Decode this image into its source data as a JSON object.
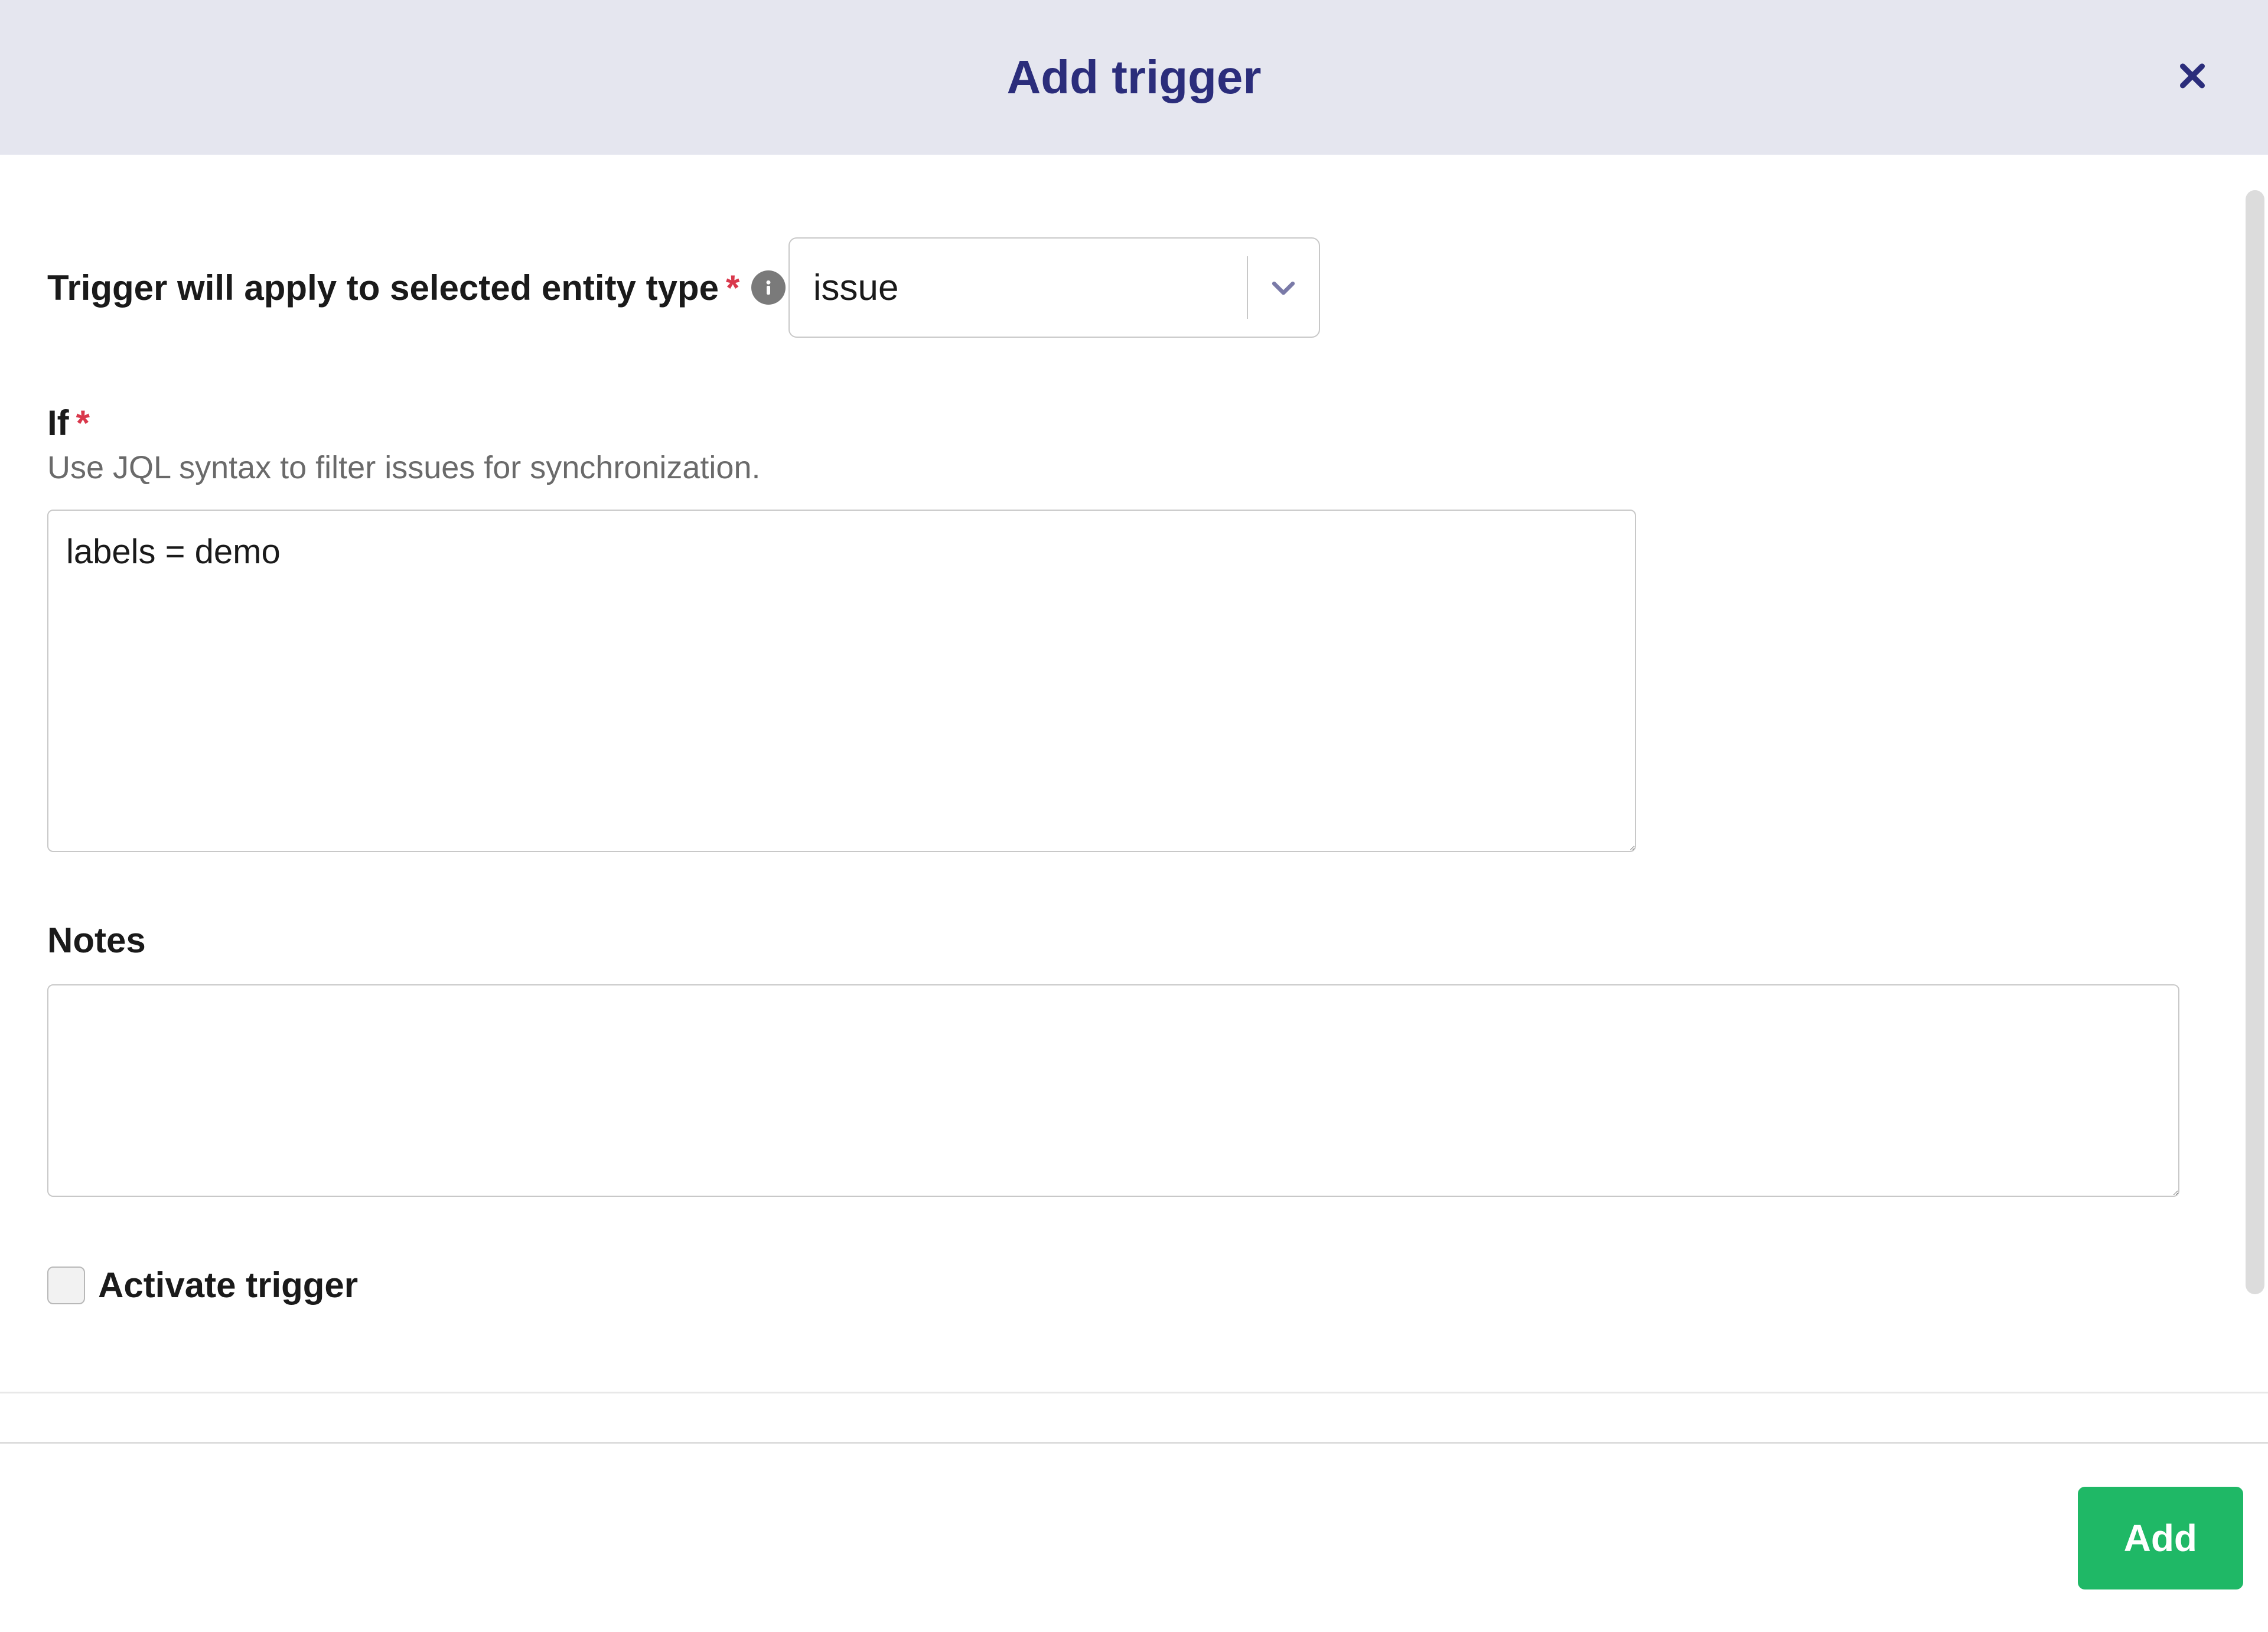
{
  "header": {
    "title": "Add trigger"
  },
  "entityType": {
    "label": "Trigger will apply to selected entity type",
    "value": "issue"
  },
  "ifSection": {
    "label": "If",
    "hint": "Use JQL syntax to filter issues for synchronization.",
    "value": "labels = demo"
  },
  "notes": {
    "label": "Notes",
    "value": ""
  },
  "activate": {
    "label": "Activate trigger",
    "checked": false
  },
  "footer": {
    "addLabel": "Add"
  }
}
